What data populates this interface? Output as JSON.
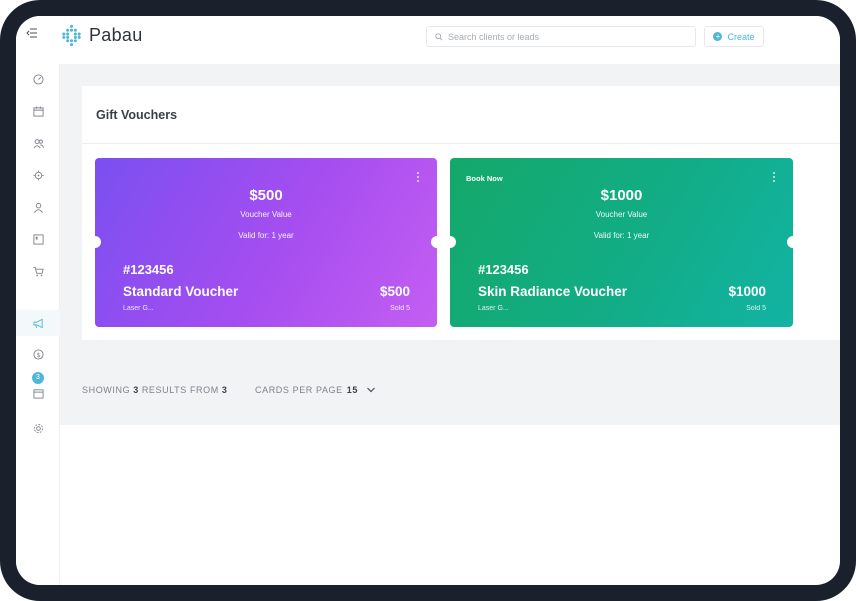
{
  "app": {
    "name": "Pabau"
  },
  "search": {
    "placeholder": "Search clients or leads"
  },
  "header": {
    "create_label": "Create"
  },
  "sidebar": {
    "items": [
      {
        "name": "dashboard-icon"
      },
      {
        "name": "calendar-icon"
      },
      {
        "name": "clients-icon"
      },
      {
        "name": "target-icon"
      },
      {
        "name": "user-icon"
      },
      {
        "name": "reports-icon"
      },
      {
        "name": "cart-icon"
      },
      {
        "name": "marketing-icon",
        "active": true
      },
      {
        "name": "dollar-icon"
      },
      {
        "name": "tasks-icon",
        "badge": "3"
      },
      {
        "name": "settings-icon"
      }
    ]
  },
  "page": {
    "title": "Gift Vouchers"
  },
  "vouchers": [
    {
      "tag": "",
      "amount": "$500",
      "value_label": "Voucher Value",
      "valid": "Valid for: 1 year",
      "code": "#123456",
      "name": "Standard Voucher",
      "price": "$500",
      "sub": "Laser G...",
      "sold": "Sold 5",
      "color": "#8a4ff1"
    },
    {
      "tag": "Book Now",
      "amount": "$1000",
      "value_label": "Voucher Value",
      "valid": "Valid for: 1 year",
      "code": "#123456",
      "name": "Skin Radiance Voucher",
      "price": "$1000",
      "sub": "Laser G...",
      "sold": "Sold 5",
      "color": "#13ab7f"
    }
  ],
  "pagination": {
    "showing_label": "SHOWING",
    "shown": "3",
    "results_from_label": "RESULTS FROM",
    "total": "3",
    "per_page_label": "CARDS PER PAGE",
    "per_page": "15"
  },
  "colors": {
    "accent": "#4fb6d8",
    "background": "#f2f3f5",
    "frame": "#1a212c"
  }
}
